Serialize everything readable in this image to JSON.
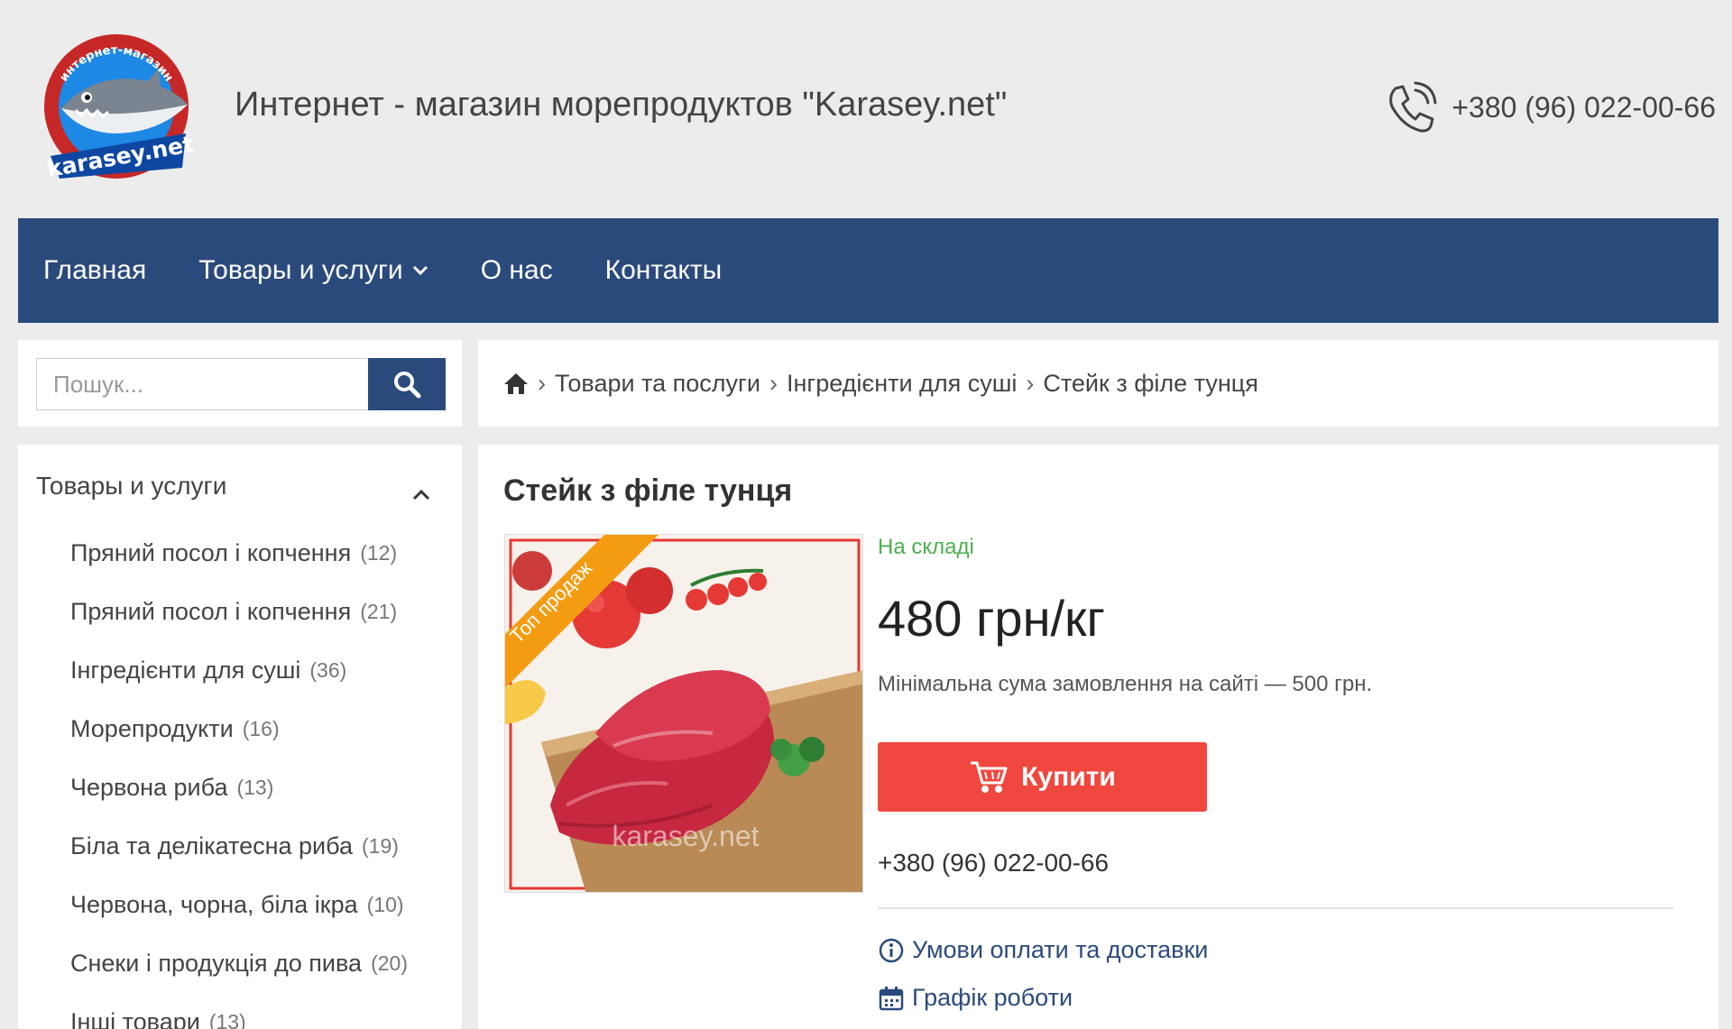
{
  "header": {
    "logo": {
      "top_text": "интернет-магазин",
      "brand": "karasey.net",
      "icon": "shark-logo"
    },
    "title": "Интернет - магазин морепродуктов \"Karasey.net\"",
    "phone": "+380 (96) 022-00-66",
    "phone_icon": "phone-icon"
  },
  "nav": {
    "items": [
      {
        "label": "Главная"
      },
      {
        "label": "Товары и услуги",
        "icon": "chevron-down-icon"
      },
      {
        "label": "О нас"
      },
      {
        "label": "Контакты"
      }
    ]
  },
  "search": {
    "placeholder": "Пошук...",
    "icon": "search-icon"
  },
  "breadcrumb": {
    "home_icon": "home-icon",
    "separator": "›",
    "items": [
      "Товари та послуги",
      "Інгредієнти для суші",
      "Стейк з філе тунця"
    ]
  },
  "sidebar": {
    "heading": "Товары и услуги",
    "toggle_icon": "chevron-up-icon",
    "categories": [
      {
        "label": "Пряний посол і копчення",
        "count": "(12)"
      },
      {
        "label": "Пряний посол і копчення",
        "count": "(21)"
      },
      {
        "label": "Інгредієнти для суші",
        "count": "(36)"
      },
      {
        "label": "Морепродукти",
        "count": "(16)"
      },
      {
        "label": "Червона риба",
        "count": "(13)"
      },
      {
        "label": "Біла та делікатесна риба",
        "count": "(19)"
      },
      {
        "label": "Червона, чорна, біла ікра",
        "count": "(10)"
      },
      {
        "label": "Снеки і продукція до пива",
        "count": "(20)"
      },
      {
        "label": "Інші товари",
        "count": "(13)"
      }
    ]
  },
  "product": {
    "title": "Стейк з філе тунця",
    "badge": "Топ продаж",
    "watermark": "karasey.net",
    "stock": "На складі",
    "price": "480 грн/кг",
    "min_order": "Мінімальна сума замовлення на сайті — 500 грн.",
    "buy_label": "Купити",
    "buy_icon": "cart-icon",
    "phone": "+380 (96) 022-00-66",
    "links": [
      {
        "label": "Умови оплати та доставки",
        "icon": "info-icon"
      },
      {
        "label": "Графік роботи",
        "icon": "calendar-icon"
      }
    ]
  },
  "colors": {
    "page_bg": "#ececec",
    "nav_bg": "#2b4a7c",
    "buy_button": "#f0483e",
    "in_stock": "#4caf50",
    "badge": "#f39c12"
  }
}
